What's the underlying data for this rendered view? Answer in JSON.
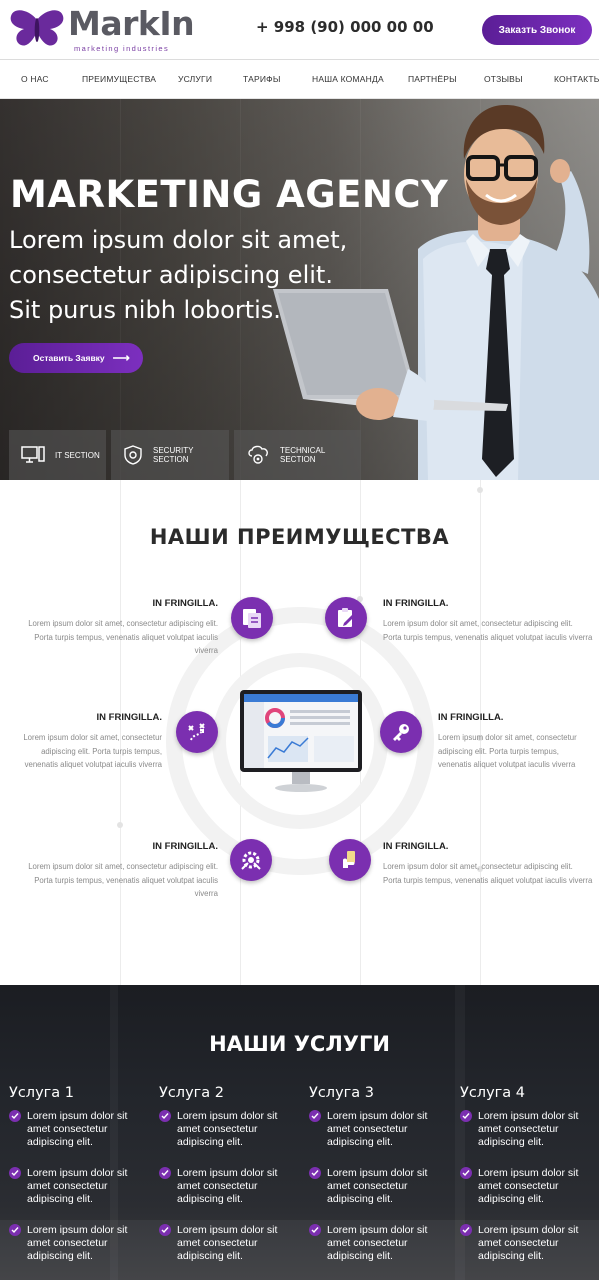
{
  "header": {
    "logo_word": "MarkIn",
    "logo_tagline": "marketing industries",
    "phone": "+ 998 (90) 000 00 00",
    "call_button": "Заказть Звонок"
  },
  "nav": {
    "items": [
      "О НАС",
      "ПРЕИМУЩЕСТВА",
      "УСЛУГИ",
      "ТАРИФЫ",
      "НАША КОМАНДА",
      "ПАРТНЁРЫ",
      "ОТЗЫВЫ",
      "КОНТАКТЫ"
    ]
  },
  "hero": {
    "title": "MARKETING AGENCY",
    "subtitle": "Lorem ipsum dolor sit amet, consectetur adipiscing elit. Sit purus nibh lobortis.",
    "button": "Оставить Заявку",
    "sections": [
      {
        "label": "IT SECTION",
        "icon": "computer-icon"
      },
      {
        "label": "SECURITY SECTION",
        "icon": "shield-icon"
      },
      {
        "label": "TECHNICAL SECTION",
        "icon": "cloud-gear-icon"
      }
    ]
  },
  "advantages": {
    "title": "НАШИ ПРЕИМУЩЕСТВА",
    "features": [
      {
        "heading": "IN FRINGILLA.",
        "text": "Lorem ipsum dolor sit amet, consectetur adipiscing elit. Porta turpis tempus, venenatis aliquet volutpat iaculis viverra",
        "icon": "documents-icon"
      },
      {
        "heading": "IN FRINGILLA.",
        "text": "Lorem ipsum dolor sit amet, consectetur adipiscing elit. Porta turpis tempus, venenatis aliquet volutpat iaculis viverra",
        "icon": "clipboard-edit-icon"
      },
      {
        "heading": "IN FRINGILLA.",
        "text": "Lorem ipsum dolor sit amet, consectetur adipiscing elit. Porta turpis tempus, venenatis aliquet volutpat iaculis viverra",
        "icon": "strategy-icon"
      },
      {
        "heading": "IN FRINGILLA.",
        "text": "Lorem ipsum dolor sit amet, consectetur adipiscing elit. Porta turpis tempus, venenatis aliquet volutpat iaculis viverra",
        "icon": "key-icon"
      },
      {
        "heading": "IN FRINGILLA.",
        "text": "Lorem ipsum dolor sit amet, consectetur adipiscing elit. Porta turpis tempus, venenatis aliquet volutpat iaculis viverra",
        "icon": "gear-tools-icon"
      },
      {
        "heading": "IN FRINGILLA.",
        "text": "Lorem ipsum dolor sit amet, consectetur adipiscing elit. Porta turpis tempus, venenatis aliquet volutpat iaculis viverra",
        "icon": "hand-money-icon"
      }
    ]
  },
  "services": {
    "title": "НАШИ УСЛУГИ",
    "columns": [
      {
        "title": "Услуга 1",
        "items": [
          "Lorem ipsum dolor sit amet consectetur adipiscing elit.",
          "Lorem ipsum dolor sit amet consectetur adipiscing elit.",
          "Lorem ipsum dolor sit amet consectetur adipiscing elit."
        ]
      },
      {
        "title": "Услуга 2",
        "items": [
          "Lorem ipsum dolor sit amet consectetur adipiscing elit.",
          "Lorem ipsum dolor sit amet consectetur adipiscing elit.",
          "Lorem ipsum dolor sit amet consectetur adipiscing elit."
        ]
      },
      {
        "title": "Услуга 3",
        "items": [
          "Lorem ipsum dolor sit amet consectetur adipiscing elit.",
          "Lorem ipsum dolor sit amet consectetur adipiscing elit.",
          "Lorem ipsum dolor sit amet consectetur adipiscing elit."
        ]
      },
      {
        "title": "Услуга 4",
        "items": [
          "Lorem ipsum dolor sit amet consectetur adipiscing elit.",
          "Lorem ipsum dolor sit amet consectetur adipiscing elit.",
          "Lorem ipsum dolor sit amet consectetur adipiscing elit."
        ]
      }
    ]
  },
  "colors": {
    "accent": "#7b2fb0",
    "accent_dark": "#5b1e96",
    "text_dark": "#2b2b2b",
    "text_muted": "#8a8a8a"
  }
}
